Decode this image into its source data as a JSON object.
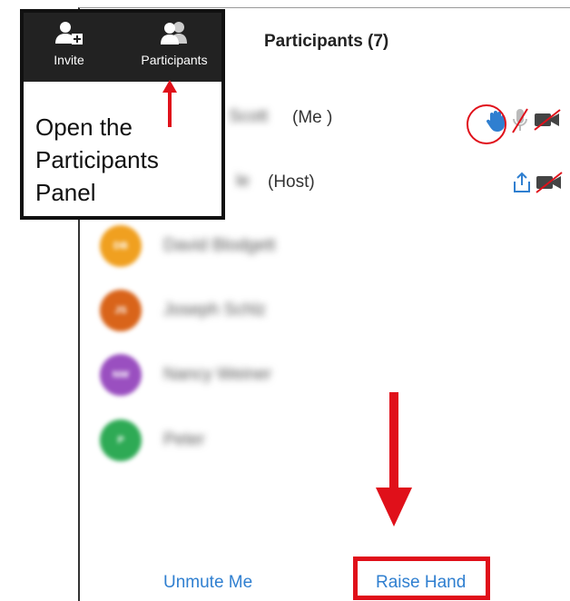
{
  "panel": {
    "title": "Participants (7)",
    "participants": [
      {
        "initials": "",
        "name": "Scott",
        "suffix": "(Me )",
        "color": ""
      },
      {
        "initials": "",
        "name": "le",
        "suffix": "(Host)",
        "color": ""
      },
      {
        "initials": "DB",
        "name": "David Blodgett",
        "suffix": "",
        "color": "#f0a020"
      },
      {
        "initials": "JS",
        "name": "Joseph Schlz",
        "suffix": "",
        "color": "#d9641a"
      },
      {
        "initials": "NW",
        "name": "Nancy Weiner",
        "suffix": "",
        "color": "#9a4fc0"
      },
      {
        "initials": "P",
        "name": "Peter",
        "suffix": "",
        "color": "#2eaa55"
      }
    ],
    "footer": {
      "unmute_label": "Unmute Me",
      "raise_hand_label": "Raise Hand"
    }
  },
  "toolbar": {
    "invite_label": "Invite",
    "participants_label": "Participants"
  },
  "callout": {
    "line1": "Open the",
    "line2": "Participants",
    "line3": "Panel"
  },
  "colors": {
    "accent_blue": "#2f7fd0",
    "annotation_red": "#e0101a",
    "toolbar_bg": "#222222"
  },
  "icons": {
    "raise_hand": "hand-icon",
    "muted_mic": "mic-muted-icon",
    "video_off": "video-off-icon",
    "share": "share-icon"
  }
}
